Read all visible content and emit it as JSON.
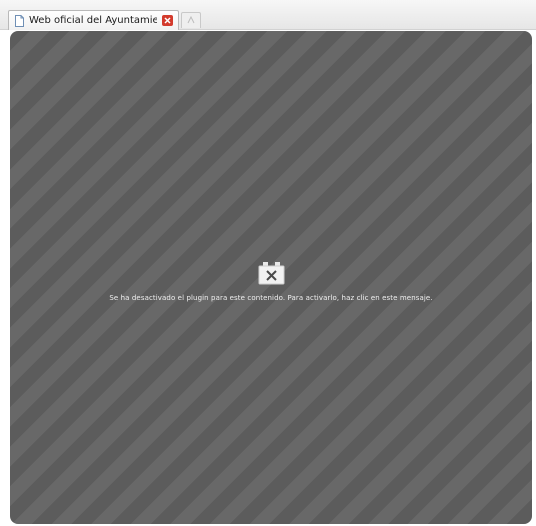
{
  "browser": {
    "tab": {
      "title": "Web oficial del Ayuntamien...",
      "close_icon": "close-icon",
      "page_icon": "page-icon"
    },
    "new_tab_icon": "new-tab-icon"
  },
  "viewport": {
    "plugin": {
      "icon": "missing-plugin-icon",
      "message": "Se ha desactivado el plugin para este contenido. Para activarlo, haz clic en este mensaje."
    }
  },
  "colors": {
    "viewport_bg": "#5f5f5f",
    "tab_close": "#d33a2c"
  }
}
